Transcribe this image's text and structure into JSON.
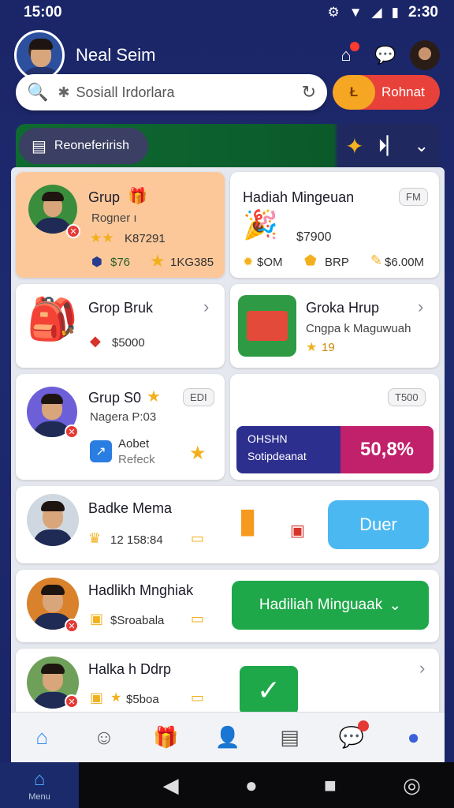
{
  "status_bar": {
    "time_left": "15:00",
    "time_right": "2:30"
  },
  "header": {
    "user_name": "Neal Seim"
  },
  "search": {
    "value": "Sosiall Irdorlara"
  },
  "promo_button": {
    "badge": "Ł",
    "label": "Rohnat"
  },
  "banner": {
    "pill_label": "Reoneferirish"
  },
  "cards": {
    "grup": {
      "title": "Grup",
      "subtitle": "Rogner ı",
      "stars_value": "K87291",
      "item1": "$76",
      "item2": "1KG385"
    },
    "hadiah": {
      "title": "Hadiah Mingeuan",
      "tag": "FM",
      "price": "$7900",
      "stat1": "$OM",
      "stat2": "BRP",
      "stat3": "$6.00M"
    },
    "grop_bruk": {
      "title": "Grop Bruk",
      "price": "$5000"
    },
    "groka": {
      "title": "Groka Hrup",
      "subtitle": "Cngpa k Maguwuah",
      "value": "19"
    },
    "grup_s0": {
      "title": "Grup S0",
      "tag": "EDI",
      "subtitle": "Nagera P:03",
      "app_name": "Aobet",
      "app_sub": "Refeck"
    },
    "progress_card": {
      "tag": "T500",
      "line1": "OHSHN",
      "line2": "Sotipdeanat",
      "percent": "50,8%"
    },
    "badke": {
      "title": "Badke Mema",
      "value": "12 158:84",
      "button": "Duer"
    },
    "hadlikh": {
      "title": "Hadlikh Mnghiak",
      "value": "$Sroabala",
      "button": "Hadiliah Minguaak"
    },
    "halka": {
      "title": "Halka h Ddrp",
      "value": "$5boa"
    }
  },
  "system_nav": {
    "home_label": "Menu"
  }
}
